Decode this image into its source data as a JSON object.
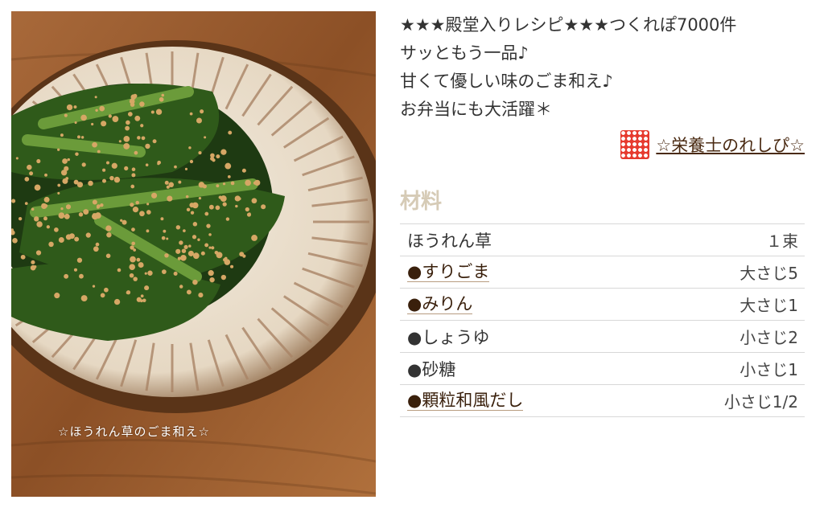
{
  "photo": {
    "alt": "ほうれん草のごま和え",
    "caption": "☆ほうれん草のごま和え☆"
  },
  "description": {
    "lines": [
      "★★★殿堂入りレシピ★★★つくれぽ7000件",
      "サッともう一品♪",
      "甘くて優しい味のごま和え♪",
      "お弁当にも大活躍＊"
    ]
  },
  "author": {
    "name": "☆栄養士のれしぴ☆",
    "icon": "polka-dot-avatar"
  },
  "ingredients_title": "材料",
  "ingredients": [
    {
      "name": "ほうれん草",
      "qty": "１束",
      "link": false
    },
    {
      "name": "●すりごま",
      "qty": "大さじ5",
      "link": true
    },
    {
      "name": "●みりん",
      "qty": "大さじ1",
      "link": true
    },
    {
      "name": "●しょうゆ",
      "qty": "小さじ2",
      "link": false
    },
    {
      "name": "●砂糖",
      "qty": "小さじ1",
      "link": false
    },
    {
      "name": "●顆粒和風だし",
      "qty": "小さじ1/2",
      "link": true
    }
  ],
  "colors": {
    "section_title": "#d6cbb6",
    "link": "#3a200c",
    "author_icon": "#e63a2e"
  }
}
